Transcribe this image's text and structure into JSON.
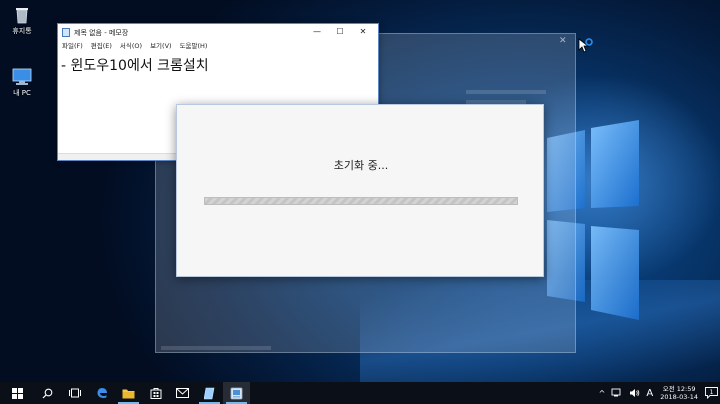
{
  "desktop": {
    "icons": [
      {
        "label": "휴지통",
        "icon": "recycle-bin-icon"
      },
      {
        "label": "내 PC",
        "icon": "computer-icon"
      }
    ]
  },
  "notepad": {
    "title": "제목 없음 - 메모장",
    "menu": [
      "파일(F)",
      "편집(E)",
      "서식(O)",
      "보기(V)",
      "도움말(H)"
    ],
    "content": "- 윈도우10에서 크롬설치",
    "controls": {
      "minimize": "—",
      "maximize": "☐",
      "close": "✕"
    }
  },
  "dialog": {
    "status": "초기화 중...",
    "progress": 0
  },
  "taskbar": {
    "apps": [
      "start-icon",
      "search-icon",
      "task-view-icon",
      "edge-icon",
      "file-explorer-icon",
      "store-icon",
      "mail-icon",
      "notepad-icon",
      "installer-icon"
    ],
    "tray": {
      "chevron": "^",
      "ime": "A",
      "time": "오전 12:59",
      "date": "2018-03-14",
      "notifications": "1"
    }
  },
  "colors": {
    "accent": "#76b9ed",
    "taskbar": "#0a0f18",
    "wallpaper": "#0b4e96"
  }
}
